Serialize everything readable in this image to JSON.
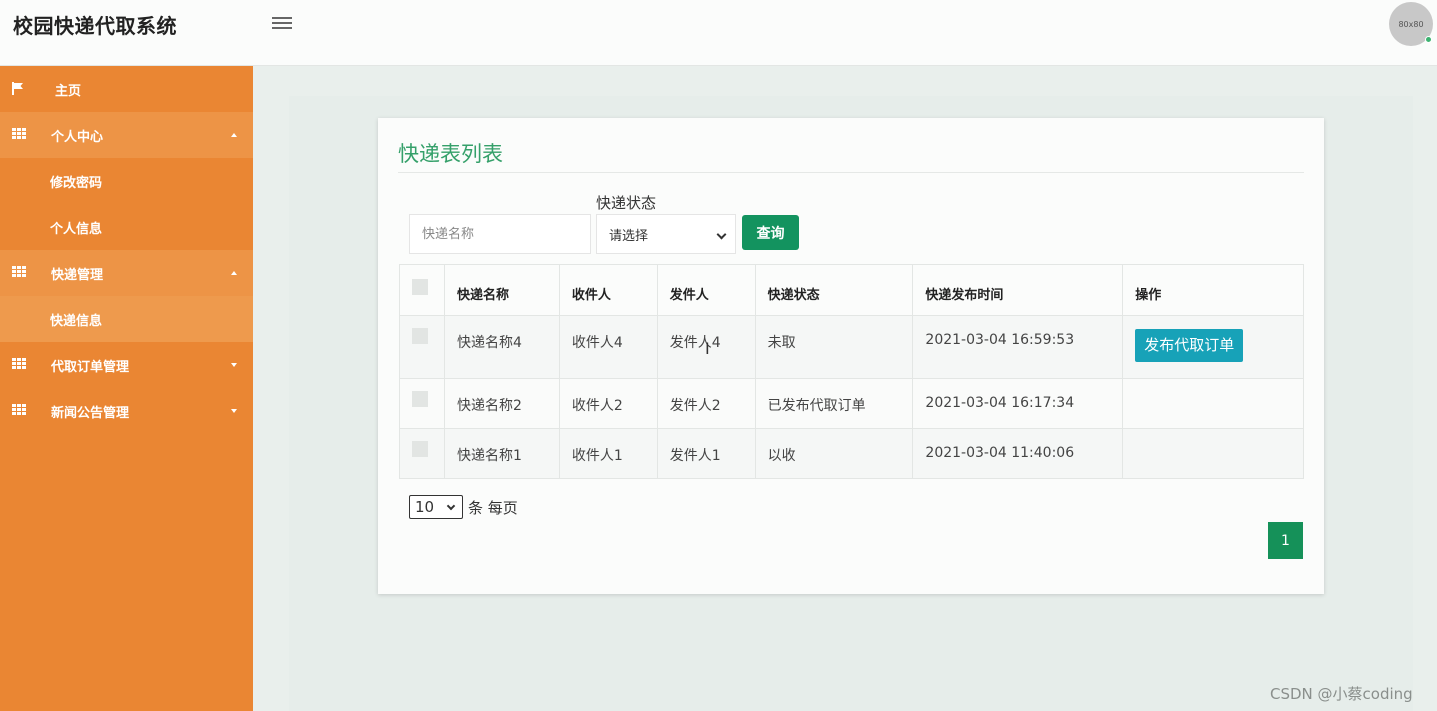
{
  "header": {
    "app_title": "校园快递代取系统",
    "avatar_text": "80x80"
  },
  "sidebar": {
    "items": [
      {
        "label": "主页",
        "icon": "flag-icon"
      },
      {
        "label": "个人中心",
        "icon": "grid-icon",
        "expanded": true,
        "children": [
          "修改密码",
          "个人信息"
        ]
      },
      {
        "label": "快递管理",
        "icon": "grid-icon",
        "expanded": true,
        "children": [
          "快递信息"
        ]
      },
      {
        "label": "代取订单管理",
        "icon": "grid-icon",
        "expanded": false
      },
      {
        "label": "新闻公告管理",
        "icon": "grid-icon",
        "expanded": false
      }
    ]
  },
  "main": {
    "title": "快递表列表",
    "search": {
      "name_placeholder": "快递名称",
      "status_label": "快递状态",
      "status_selected": "请选择",
      "query_button": "查询"
    },
    "table": {
      "headers": [
        "快递名称",
        "收件人",
        "发件人",
        "快递状态",
        "快递发布时间",
        "操作"
      ],
      "rows": [
        {
          "name": "快递名称4",
          "receiver": "收件人4",
          "sender": "发件人4",
          "status": "未取",
          "time": "2021-03-04 16:59:53",
          "action": "发布代取订单"
        },
        {
          "name": "快递名称2",
          "receiver": "收件人2",
          "sender": "发件人2",
          "status": "已发布代取订单",
          "time": "2021-03-04 16:17:34",
          "action": ""
        },
        {
          "name": "快递名称1",
          "receiver": "收件人1",
          "sender": "发件人1",
          "status": "以收",
          "time": "2021-03-04 11:40:06",
          "action": ""
        }
      ]
    },
    "pagination": {
      "page_size": "10",
      "page_size_suffix": "条 每页",
      "current_page": "1"
    }
  },
  "watermark": "CSDN @小蔡coding",
  "colors": {
    "sidebar": "#ea8633",
    "title": "#35a06a",
    "primary": "#13935f",
    "action": "#17a2b8"
  }
}
